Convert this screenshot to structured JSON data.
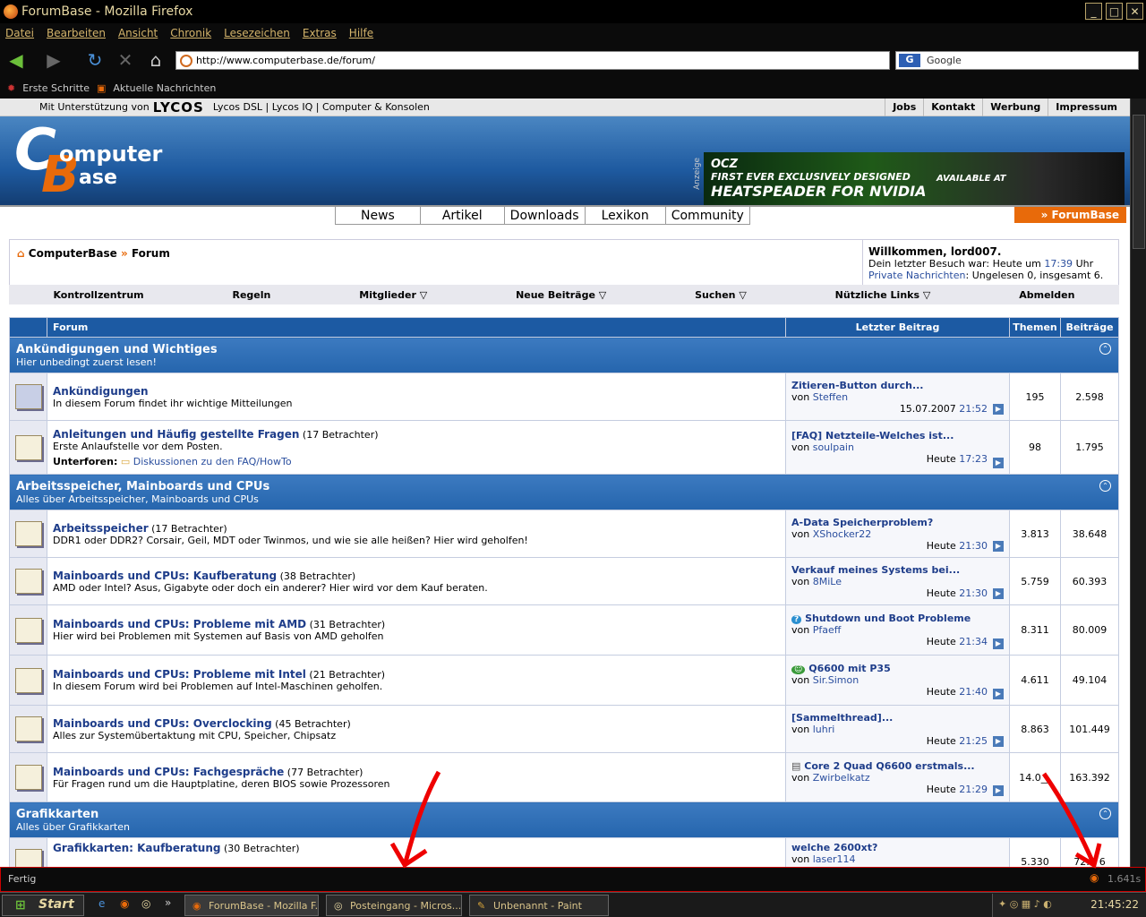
{
  "window": {
    "title": "ForumBase - Mozilla Firefox"
  },
  "menu": [
    "Datei",
    "Bearbeiten",
    "Ansicht",
    "Chronik",
    "Lesezeichen",
    "Extras",
    "Hilfe"
  ],
  "nav": {
    "url": "http://www.computerbase.de/forum/",
    "search_placeholder": "Google"
  },
  "bookmarks": [
    "Erste Schritte",
    "Aktuelle Nachrichten"
  ],
  "sponsor": {
    "prefix": "Mit Unterstützung von",
    "brand": "LYCOS",
    "links": "Lycos DSL | Lycos IQ | Computer & Konsolen",
    "toplinks": [
      "Jobs",
      "Kontakt",
      "Werbung",
      "Impressum"
    ]
  },
  "logo": {
    "w1": "omputer",
    "w2": "ase"
  },
  "ad": {
    "label": "Anzeige",
    "line1": "FIRST EVER EXCLUSIVELY DESIGNED",
    "line2": "HEATSPEADER FOR NVIDIA",
    "line3": "AVAILABLE AT",
    "brand": "OCZ"
  },
  "mainnav": [
    "News",
    "Artikel",
    "Downloads",
    "Lexikon",
    "Community"
  ],
  "forumtab": "» ForumBase",
  "breadcrumb": {
    "home": "ComputerBase",
    "sep": "»",
    "current": "Forum"
  },
  "welcome": {
    "title": "Willkommen, lord007.",
    "last_visit_prefix": "Dein letzter Besuch war: Heute um",
    "last_visit_time": "17:39",
    "last_visit_suffix": "Uhr",
    "pm_link": "Private Nachrichten",
    "pm_text": ": Ungelesen 0, insgesamt 6."
  },
  "subnav": [
    "Kontrollzentrum",
    "Regeln",
    "Mitglieder ▽",
    "Neue Beiträge ▽",
    "Suchen ▽",
    "Nützliche Links ▽",
    "Abmelden"
  ],
  "table_headers": {
    "forum": "Forum",
    "last": "Letzter Beitrag",
    "topics": "Themen",
    "posts": "Beiträge"
  },
  "categories": [
    {
      "title": "Ankündigungen und Wichtiges",
      "desc": "Hier unbedingt zuerst lesen!"
    },
    {
      "title": "Arbeitsspeicher, Mainboards und CPUs",
      "desc": "Alles über Arbeitsspeicher, Mainboards und CPUs"
    },
    {
      "title": "Grafikkarten",
      "desc": "Alles über Grafikkarten"
    }
  ],
  "forums": [
    {
      "name": "Ankündigungen",
      "viewers": "",
      "desc": "In diesem Forum findet ihr wichtige Mitteilungen",
      "last_title": "Zitieren-Button durch...",
      "by": "Steffen",
      "date": "15.07.2007",
      "time": "21:52",
      "topics": "195",
      "posts": "2.598"
    },
    {
      "name": "Anleitungen und Häufig gestellte Fragen",
      "viewers": "(17 Betrachter)",
      "desc": "Erste Anlaufstelle vor dem Posten.",
      "sub_label": "Unterforen:",
      "sub": "Diskussionen zu den FAQ/HowTo",
      "last_title": "[FAQ] Netzteile-Welches ist...",
      "by": "soulpain",
      "date": "Heute",
      "time": "17:23",
      "topics": "98",
      "posts": "1.795"
    },
    {
      "name": "Arbeitsspeicher",
      "viewers": "(17 Betrachter)",
      "desc": "DDR1 oder DDR2? Corsair, Geil, MDT oder Twinmos, und wie sie alle heißen? Hier wird geholfen!",
      "last_title": "A-Data Speicherproblem?",
      "by": "XShocker22",
      "date": "Heute",
      "time": "21:30",
      "topics": "3.813",
      "posts": "38.648"
    },
    {
      "name": "Mainboards und CPUs: Kaufberatung",
      "viewers": "(38 Betrachter)",
      "desc": "AMD oder Intel? Asus, Gigabyte oder doch ein anderer? Hier wird vor dem Kauf beraten.",
      "last_title": "Verkauf meines Systems bei...",
      "by": "8MiLe",
      "date": "Heute",
      "time": "21:30",
      "topics": "5.759",
      "posts": "60.393"
    },
    {
      "name": "Mainboards und CPUs: Probleme mit AMD",
      "viewers": "(31 Betrachter)",
      "desc": "Hier wird bei Problemen mit Systemen auf Basis von AMD geholfen",
      "last_title": "Shutdown und Boot Probleme",
      "by": "Pfaeff",
      "date": "Heute",
      "time": "21:34",
      "topics": "8.311",
      "posts": "80.009"
    },
    {
      "name": "Mainboards und CPUs: Probleme mit Intel",
      "viewers": "(21 Betrachter)",
      "desc": "In diesem Forum wird bei Problemen auf Intel-Maschinen geholfen.",
      "last_title": "Q6600 mit P35",
      "by": "Sir.Simon",
      "date": "Heute",
      "time": "21:40",
      "topics": "4.611",
      "posts": "49.104"
    },
    {
      "name": "Mainboards und CPUs: Overclocking",
      "viewers": "(45 Betrachter)",
      "desc": "Alles zur Systemübertaktung mit CPU, Speicher, Chipsatz",
      "last_title": "[Sammelthread]...",
      "by": "luhri",
      "date": "Heute",
      "time": "21:25",
      "topics": "8.863",
      "posts": "101.449"
    },
    {
      "name": "Mainboards und CPUs: Fachgespräche",
      "viewers": "(77 Betrachter)",
      "desc": "Für Fragen rund um die Hauptplatine, deren BIOS sowie Prozessoren",
      "last_title": "Core 2 Quad Q6600 erstmals...",
      "by": "Zwirbelkatz",
      "date": "Heute",
      "time": "21:29",
      "topics": "14.0__",
      "posts": "163.392"
    },
    {
      "name": "Grafikkarten: Kaufberatung",
      "viewers": "(30 Betrachter)",
      "desc": "",
      "last_title": "welche 2600xt?",
      "by": "laser114",
      "date": "",
      "time": "",
      "topics": "5.330",
      "posts": "72.__6"
    }
  ],
  "by_label": "von",
  "status": {
    "text": "Fertig",
    "right": "1.641s"
  },
  "taskbar": {
    "start": "Start",
    "tasks": [
      "ForumBase - Mozilla F...",
      "Posteingang - Micros...",
      "Unbenannt - Paint"
    ],
    "clock": "21:45:22"
  }
}
